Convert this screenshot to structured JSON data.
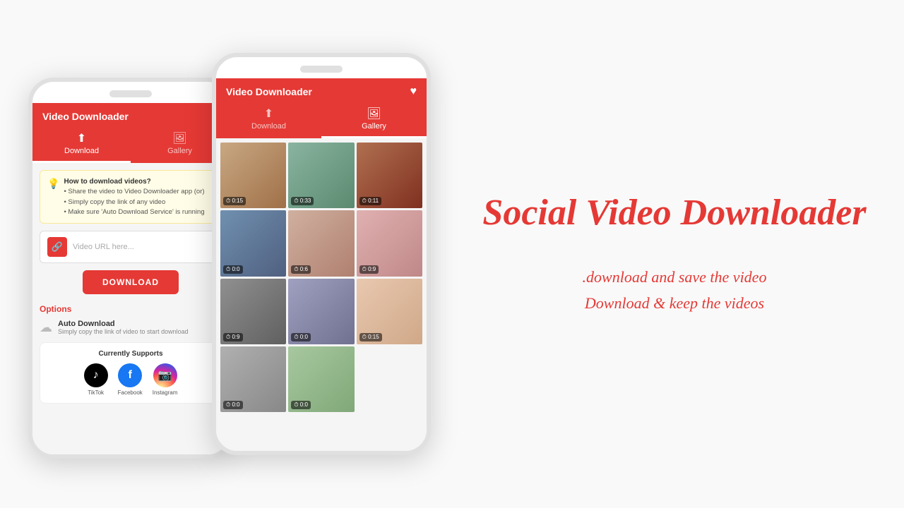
{
  "app": {
    "title": "Video Downloader",
    "heart": "♥",
    "tabs": [
      {
        "id": "download",
        "label": "Download",
        "icon": "⬆",
        "active": true
      },
      {
        "id": "gallery",
        "label": "Gallery",
        "icon": "🖼",
        "active": false
      }
    ]
  },
  "phone1": {
    "info": {
      "title": "How to download videos?",
      "bullets": [
        "Share the video to Video Downloader app (or)",
        "Simply copy the link of any video",
        "Make sure 'Auto Download Service' is running"
      ]
    },
    "url_placeholder": "Video URL here...",
    "download_button": "DOWNLOAD",
    "options_label": "Options",
    "auto_download": {
      "title": "Auto Download",
      "subtitle": "Simply copy the link of video to start download"
    },
    "supports": {
      "title": "Currently Supports",
      "socials": [
        {
          "name": "TikTok",
          "class": "social-tiktok",
          "symbol": "♪"
        },
        {
          "name": "Facebook",
          "class": "social-facebook",
          "symbol": "f"
        },
        {
          "name": "Instagram",
          "class": "social-instagram",
          "symbol": "📷"
        }
      ]
    }
  },
  "phone2": {
    "tabs": [
      {
        "id": "download",
        "label": "Download",
        "active": false
      },
      {
        "id": "gallery",
        "label": "Gallery",
        "active": true
      }
    ],
    "gallery": {
      "thumbs": [
        {
          "id": 1,
          "cls": "t1",
          "duration": "0:15"
        },
        {
          "id": 2,
          "cls": "t2",
          "duration": "0:33"
        },
        {
          "id": 3,
          "cls": "t3",
          "duration": "0:11"
        },
        {
          "id": 4,
          "cls": "t4",
          "duration": "0:0"
        },
        {
          "id": 5,
          "cls": "t5",
          "duration": "0:6"
        },
        {
          "id": 6,
          "cls": "t6",
          "duration": "0:9"
        },
        {
          "id": 7,
          "cls": "t7",
          "duration": "0:9"
        },
        {
          "id": 8,
          "cls": "t8",
          "duration": "0:0"
        },
        {
          "id": 9,
          "cls": "t9",
          "duration": "0:15"
        },
        {
          "id": 10,
          "cls": "t10",
          "duration": "0:0"
        },
        {
          "id": 11,
          "cls": "t11",
          "duration": "0:0"
        }
      ]
    }
  },
  "right": {
    "main_title": "Social Video Downloader",
    "subtitle_lines": [
      ".download and save the video",
      "Download & keep the videos"
    ]
  }
}
